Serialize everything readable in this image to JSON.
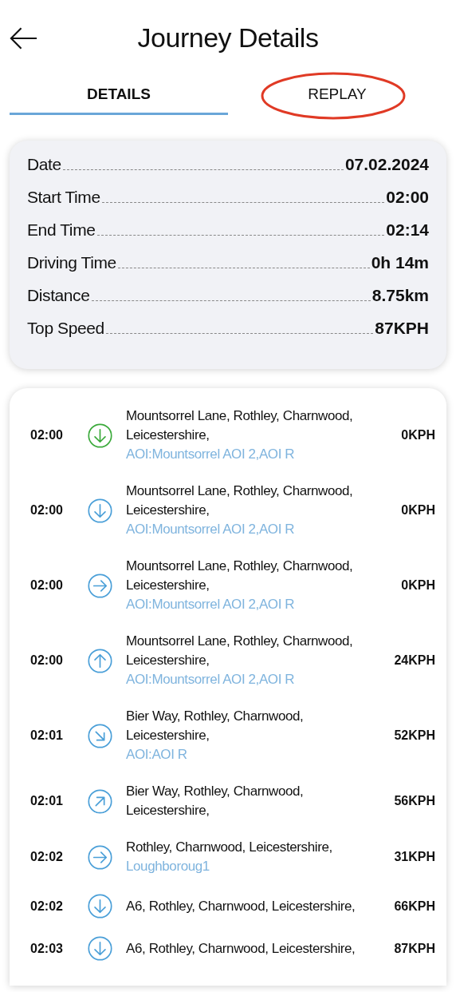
{
  "header": {
    "title": "Journey Details"
  },
  "tabs": [
    {
      "label": "DETAILS",
      "selected": true,
      "circled": false
    },
    {
      "label": "REPLAY",
      "selected": false,
      "circled": true
    }
  ],
  "summary": [
    {
      "label": "Date",
      "value": "07.02.2024"
    },
    {
      "label": "Start Time",
      "value": "02:00"
    },
    {
      "label": "End Time",
      "value": "02:14"
    },
    {
      "label": "Driving Time",
      "value": "0h 14m"
    },
    {
      "label": "Distance",
      "value": "8.75km"
    },
    {
      "label": "Top Speed",
      "value": "87KPH"
    }
  ],
  "events": [
    {
      "time": "02:00",
      "kind": "down",
      "color": "#3aa93a",
      "address": "Mountsorrel Lane, Rothley, Charnwood, Leicestershire,",
      "area": "AOI:Mountsorrel AOI 2,AOI R",
      "speed": "0KPH"
    },
    {
      "time": "02:00",
      "kind": "down",
      "color": "#4a9fd8",
      "address": "Mountsorrel Lane, Rothley, Charnwood, Leicestershire,",
      "area": "AOI:Mountsorrel AOI 2,AOI R",
      "speed": "0KPH"
    },
    {
      "time": "02:00",
      "kind": "right",
      "color": "#4a9fd8",
      "address": "Mountsorrel Lane, Rothley, Charnwood, Leicestershire,",
      "area": "AOI:Mountsorrel AOI 2,AOI R",
      "speed": "0KPH"
    },
    {
      "time": "02:00",
      "kind": "up",
      "color": "#4a9fd8",
      "address": "Mountsorrel Lane, Rothley, Charnwood, Leicestershire,",
      "area": "AOI:Mountsorrel AOI 2,AOI R",
      "speed": "24KPH"
    },
    {
      "time": "02:01",
      "kind": "down-right",
      "color": "#4a9fd8",
      "address": "Bier Way, Rothley, Charnwood, Leicestershire,",
      "area": "AOI:AOI R",
      "speed": "52KPH"
    },
    {
      "time": "02:01",
      "kind": "up-right",
      "color": "#4a9fd8",
      "address": "Bier Way, Rothley, Charnwood, Leicestershire,",
      "speed": "56KPH"
    },
    {
      "time": "02:02",
      "kind": "right",
      "color": "#4a9fd8",
      "address": "Rothley, Charnwood, Leicestershire,",
      "area": "Loughboroug1",
      "speed": "31KPH"
    },
    {
      "time": "02:02",
      "kind": "down",
      "color": "#4a9fd8",
      "address": "A6, Rothley, Charnwood, Leicestershire,",
      "speed": "66KPH"
    },
    {
      "time": "02:03",
      "kind": "down",
      "color": "#4a9fd8",
      "address": "A6, Rothley, Charnwood, Leicestershire,",
      "speed": "87KPH"
    }
  ]
}
